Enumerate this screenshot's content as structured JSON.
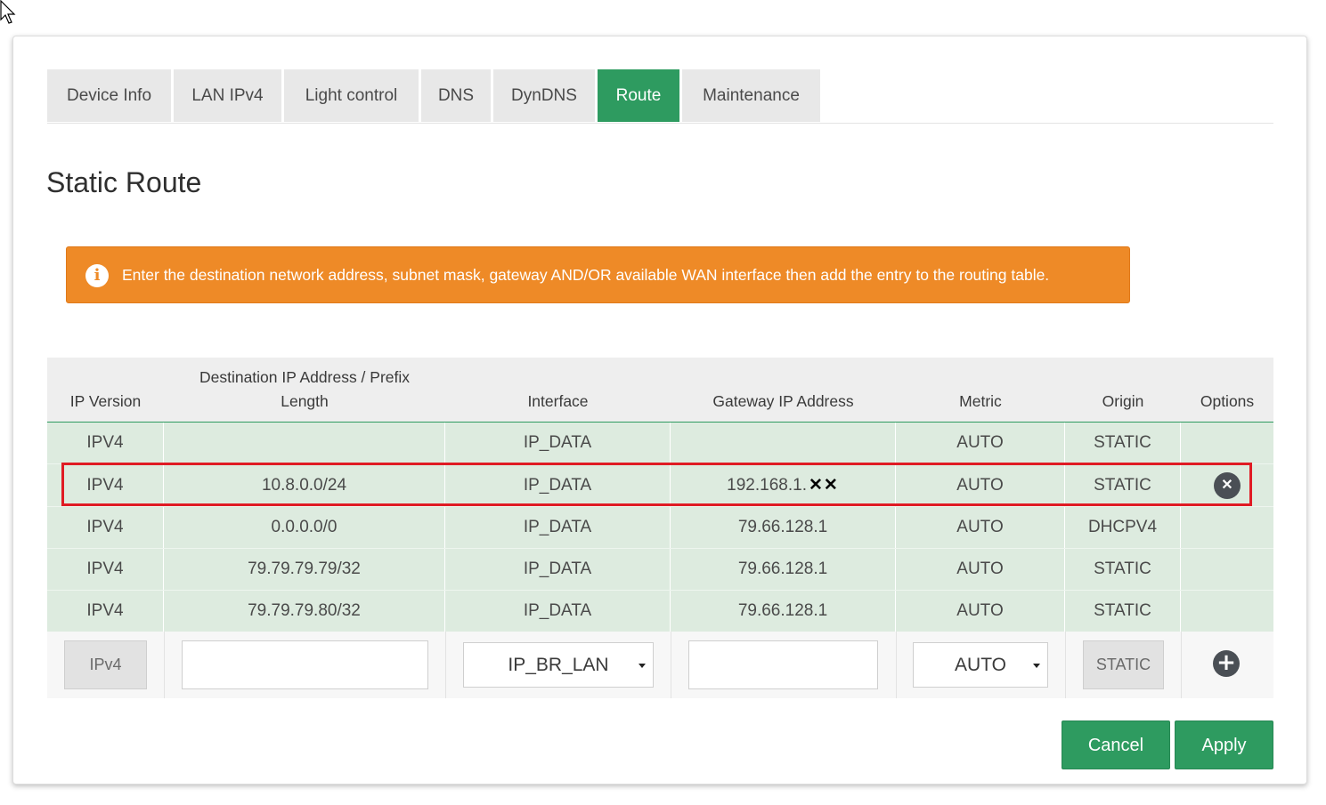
{
  "tabs": [
    {
      "label": "Device Info"
    },
    {
      "label": "LAN IPv4"
    },
    {
      "label": "Light control"
    },
    {
      "label": "DNS"
    },
    {
      "label": "DynDNS"
    },
    {
      "label": "Route",
      "active": true
    },
    {
      "label": "Maintenance"
    }
  ],
  "title": "Static Route",
  "banner": {
    "text": "Enter the destination network address, subnet mask, gateway AND/OR available WAN interface then add the entry to the routing table.",
    "icon": "info-icon",
    "color": "#ee8a27"
  },
  "table": {
    "headers": {
      "ip_version": "IP Version",
      "destination_line1": "Destination IP Address / Prefix",
      "destination_line2": "Length",
      "interface": "Interface",
      "gateway": "Gateway IP Address",
      "metric": "Metric",
      "origin": "Origin",
      "options": "Options"
    },
    "rows": [
      {
        "ip_version": "IPV4",
        "destination": "",
        "interface": "IP_DATA",
        "gateway": "",
        "metric": "AUTO",
        "origin": "STATIC"
      },
      {
        "ip_version": "IPV4",
        "destination": "10.8.0.0/24",
        "interface": "IP_DATA",
        "gateway": "192.168.1.",
        "gateway_redacted": "✕✕",
        "metric": "AUTO",
        "origin": "STATIC",
        "removable": true
      },
      {
        "ip_version": "IPV4",
        "destination": "0.0.0.0/0",
        "interface": "IP_DATA",
        "gateway": "79.66.128.1",
        "metric": "AUTO",
        "origin": "DHCPV4"
      },
      {
        "ip_version": "IPV4",
        "destination": "79.79.79.79/32",
        "interface": "IP_DATA",
        "gateway": "79.66.128.1",
        "metric": "AUTO",
        "origin": "STATIC"
      },
      {
        "ip_version": "IPV4",
        "destination": "79.79.79.80/32",
        "interface": "IP_DATA",
        "gateway": "79.66.128.1",
        "metric": "AUTO",
        "origin": "STATIC"
      }
    ],
    "new_entry": {
      "ip_version": "IPv4",
      "destination_value": "",
      "interface_selected": "IP_BR_LAN",
      "gateway_value": "",
      "metric_selected": "AUTO",
      "origin": "STATIC"
    }
  },
  "buttons": {
    "cancel": "Cancel",
    "apply": "Apply"
  },
  "colors": {
    "accent": "#2e9b60",
    "row_bg": "#ddebdf",
    "highlight": "#e01b24"
  }
}
